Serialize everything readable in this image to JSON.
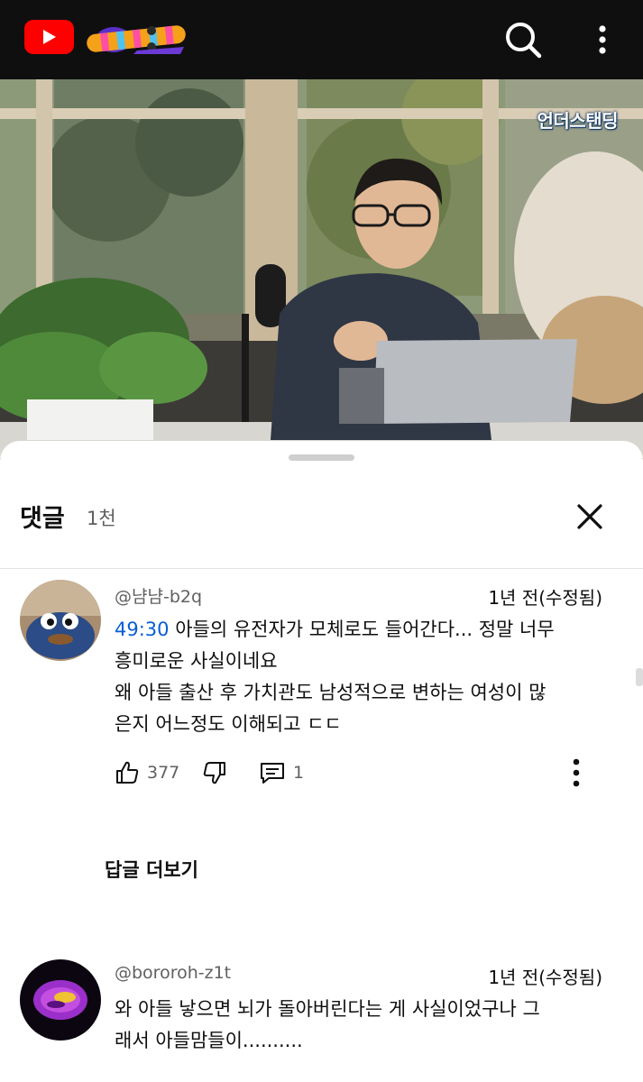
{
  "header": {
    "logo_icon": "youtube-logo-icon",
    "doodle_icon": "youtube-doodle-icon",
    "search_icon": "search-icon",
    "menu_icon": "more-vert-icon"
  },
  "video": {
    "watermark": "언더스탠딩"
  },
  "comments_panel": {
    "title": "댓글",
    "count": "1천",
    "close_icon": "close-icon",
    "comments": [
      {
        "author": "@냠냠-b2q",
        "time": "1년 전(수정됨)",
        "timestamp_link": "49:30",
        "text_first": " 아들의 유전자가 모체로도 들어간다... 정말 너무",
        "text_rest": "흥미로운 사실이네요\n왜 아들 출산 후 가치관도 남성적으로 변하는 여성이 많\n은지 어느정도 이해되고 ㄷㄷ",
        "likes": "377",
        "replies": "1",
        "more_replies": "답글 더보기"
      },
      {
        "author": "@bororoh-z1t",
        "time": "1년 전(수정됨)",
        "text": "와 아들 낳으면 뇌가 돌아버린다는 게 사실이었구나 그\n래서 아들맘들이.........."
      }
    ]
  },
  "colors": {
    "accent_red": "#ff0000",
    "link_blue": "#065fd4",
    "dark_bg": "#0f0f0f"
  }
}
